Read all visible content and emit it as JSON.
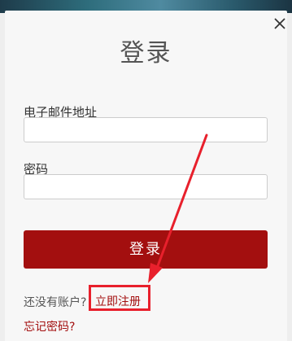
{
  "dialog": {
    "title": "登录",
    "email_label": "电子邮件地址",
    "email_value": "",
    "password_label": "密码",
    "password_value": "",
    "submit_label": "登录",
    "no_account_text": "还没有账户?",
    "register_label": "立即注册",
    "forgot_label": "忘记密码?"
  },
  "colors": {
    "accent": "#a30f0f",
    "annotation": "#e8202c"
  },
  "icons": {
    "close": "close-icon"
  }
}
